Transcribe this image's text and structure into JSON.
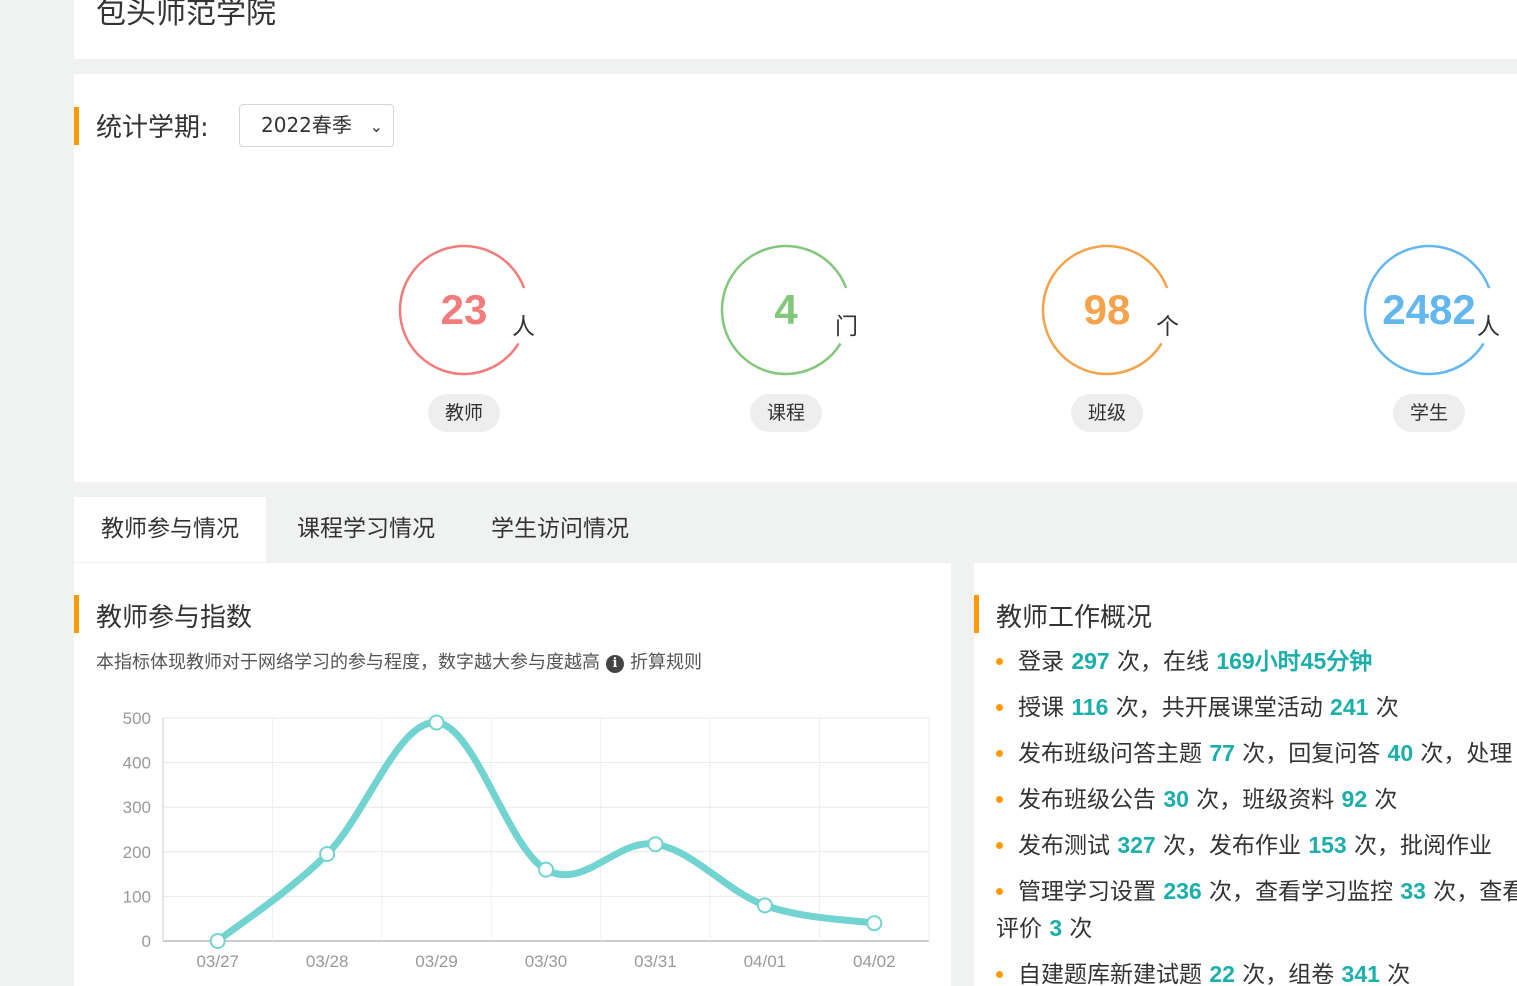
{
  "header": {
    "school_name": "包头师范学院"
  },
  "term": {
    "label": "统计学期:",
    "selected": "2022春季"
  },
  "stats": [
    {
      "value": "23",
      "unit": "人",
      "label": "教师",
      "color": "#f27b7b"
    },
    {
      "value": "4",
      "unit": "门",
      "label": "课程",
      "color": "#82c77c"
    },
    {
      "value": "98",
      "unit": "个",
      "label": "班级",
      "color": "#f5a34b"
    },
    {
      "value": "2482",
      "unit": "人",
      "label": "学生",
      "color": "#63b7ef"
    }
  ],
  "tabs": [
    {
      "label": "教师参与情况",
      "active": true
    },
    {
      "label": "课程学习情况",
      "active": false
    },
    {
      "label": "学生访问情况",
      "active": false
    }
  ],
  "participation": {
    "title": "教师参与指数",
    "description": "本指标体现教师对于网络学习的参与程度，数字越大参与度越高",
    "rule_link": "折算规则"
  },
  "chart_data": {
    "type": "line",
    "categories": [
      "03/27",
      "03/28",
      "03/29",
      "03/30",
      "03/31",
      "04/01",
      "04/02"
    ],
    "values": [
      0,
      195,
      490,
      160,
      217,
      80,
      40
    ],
    "ylim": [
      0,
      500
    ],
    "yticks": [
      "0",
      "100",
      "200",
      "300",
      "400",
      "500"
    ],
    "grid": true,
    "smooth": true,
    "line_color": "#72d4d0"
  },
  "work": {
    "title": "教师工作概况",
    "items": [
      [
        "登录 ",
        {
          "v": "297"
        },
        " 次，在线 ",
        {
          "v": "169小时45分钟"
        }
      ],
      [
        "授课 ",
        {
          "v": "116"
        },
        " 次，共开展课堂活动 ",
        {
          "v": "241"
        },
        " 次"
      ],
      [
        "发布班级问答主题 ",
        {
          "v": "77"
        },
        " 次，回复问答 ",
        {
          "v": "40"
        },
        " 次，处理"
      ],
      [
        "发布班级公告 ",
        {
          "v": "30"
        },
        " 次，班级资料 ",
        {
          "v": "92"
        },
        " 次"
      ],
      [
        "发布测试 ",
        {
          "v": "327"
        },
        " 次，发布作业 ",
        {
          "v": "153"
        },
        " 次，批阅作业"
      ],
      [
        "管理学习设置 ",
        {
          "v": "236"
        },
        " 次，查看学习监控 ",
        {
          "v": "33"
        },
        " 次，查看评价 ",
        {
          "v": "3"
        },
        " 次"
      ],
      [
        "自建题库新建试题 ",
        {
          "v": "22"
        },
        " 次，组卷 ",
        {
          "v": "341"
        },
        " 次"
      ]
    ]
  }
}
